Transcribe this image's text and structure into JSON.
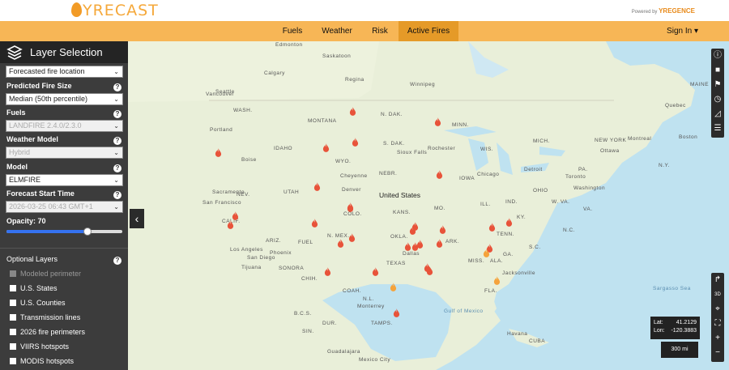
{
  "brand": {
    "logo_text": "YRECAST",
    "powered_by": "Powered by",
    "powered_brand": "YREGENCE"
  },
  "nav": {
    "tabs": [
      {
        "label": "Fuels"
      },
      {
        "label": "Weather"
      },
      {
        "label": "Risk"
      },
      {
        "label": "Active Fires"
      }
    ],
    "active": "Active Fires",
    "signin": "Sign In"
  },
  "sidebar": {
    "title": "Layer Selection",
    "forecast_select": "Forecasted fire location",
    "fire_size": {
      "label": "Predicted Fire Size",
      "value": "Median (50th percentile)"
    },
    "fuels": {
      "label": "Fuels",
      "value": "LANDFIRE 2.4.0/2.3.0"
    },
    "weather_model": {
      "label": "Weather Model",
      "value": "Hybrid"
    },
    "model": {
      "label": "Model",
      "value": "ELMFIRE"
    },
    "start_time": {
      "label": "Forecast Start Time",
      "value": "2026-03-25 06:43 GMT+1"
    },
    "opacity": {
      "label": "Opacity: 70",
      "value": 0.7
    },
    "optional": {
      "label": "Optional Layers",
      "items": [
        {
          "label": "Modeled perimeter",
          "disabled": true
        },
        {
          "label": "U.S. States"
        },
        {
          "label": "U.S. Counties"
        },
        {
          "label": "Transmission lines"
        },
        {
          "label": "2026 fire perimeters"
        },
        {
          "label": "VIIRS hotspots"
        },
        {
          "label": "MODIS hotspots"
        }
      ]
    }
  },
  "map": {
    "labels": [
      "Edmonton",
      "Calgary",
      "Saskatoon",
      "Regina",
      "Winnipeg",
      "Vancouver",
      "WASH.",
      "MONTANA",
      "N. DAK.",
      "Ottawa",
      "Montreal",
      "Quebec",
      "Toronto",
      "Chicago",
      "Detroit",
      "IDAHO",
      "WYO.",
      "S. DAK.",
      "Sioux Falls",
      "Rochester",
      "Boise",
      "Seattle",
      "Portland",
      "MINN.",
      "MICH.",
      "WIS.",
      "IOWA",
      "NEBR.",
      "ILL.",
      "IND.",
      "OHIO",
      "PA.",
      "NEW YORK",
      "Boston",
      "N.Y.",
      "MAINE",
      "Cheyenne",
      "Denver",
      "United States",
      "NEV.",
      "UTAH",
      "COLO.",
      "KANS.",
      "MO.",
      "KY.",
      "W. VA.",
      "VA.",
      "Washington",
      "TENN.",
      "N.C.",
      "S.C.",
      "ARK.",
      "MISS.",
      "ALA.",
      "GA.",
      "OKLA.",
      "TEXAS",
      "Dallas",
      "N. MEX.",
      "ARIZ.",
      "CALIF.",
      "Los Angeles",
      "San Diego",
      "Phoenix",
      "FUEL",
      "San Francisco",
      "Sacramento",
      "Tijuana",
      "CHIH.",
      "SONORA",
      "COAH.",
      "N.L.",
      "B.C.S.",
      "DUR.",
      "Monterrey",
      "TAMPS.",
      "SIN.",
      "Gulf of Mexico",
      "Jacksonville",
      "FLA.",
      "Havana",
      "CUBA",
      "Sargasso Sea",
      "Mexico City",
      "Guadalajara"
    ],
    "coords": {
      "lat_label": "Lat:",
      "lat": "41.2129",
      "lon_label": "Lon:",
      "lon": "-120.3883"
    },
    "scale": "300 mi"
  },
  "toolbar": {
    "icons": [
      "info-icon",
      "video-icon",
      "flag-icon",
      "clock-icon",
      "ruler-icon",
      "list-icon"
    ],
    "icons2": [
      "share-icon",
      "3d-icon",
      "locate-icon",
      "fullscreen-icon",
      "zoom-in-icon",
      "zoom-out-icon"
    ]
  }
}
